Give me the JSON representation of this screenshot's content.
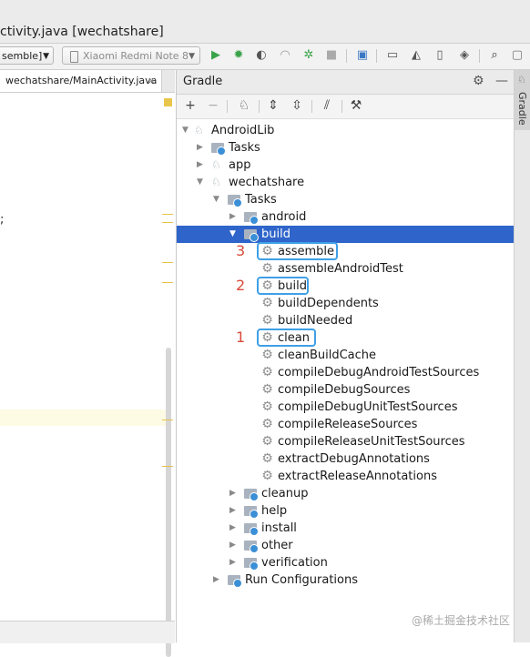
{
  "window": {
    "title": "ctivity.java [wechatshare]"
  },
  "toolbar": {
    "config_combo": "semble]",
    "device_combo": "Xiaomi Redmi Note 8",
    "icons": [
      "run-icon",
      "debug-icon",
      "profile-icon",
      "attach-icon",
      "apply-changes-icon",
      "stop-icon",
      "sync-icon",
      "sdk-manager-icon",
      "avd-manager-icon",
      "device-icon",
      "layout-inspector-icon",
      "search-icon",
      "more-icon"
    ]
  },
  "editor": {
    "tab_label": "wechatshare/MainActivity.java",
    "close_symbol": "×",
    "code_fragment": ";"
  },
  "gradle": {
    "title": "Gradle",
    "settings_symbol": "⚙",
    "minimize_symbol": "—",
    "toolbar": {
      "add": "+",
      "remove": "−"
    },
    "tree": [
      {
        "label": "AndroidLib",
        "level": 0,
        "expanded": true,
        "icon": "elephant-icon"
      },
      {
        "label": "Tasks",
        "level": 1,
        "expanded": false,
        "icon": "folder-icon"
      },
      {
        "label": "app",
        "level": 1,
        "expanded": false,
        "icon": "elephant-icon"
      },
      {
        "label": "wechatshare",
        "level": 1,
        "expanded": true,
        "icon": "elephant-icon"
      },
      {
        "label": "Tasks",
        "level": 2,
        "expanded": true,
        "icon": "folder-icon"
      },
      {
        "label": "android",
        "level": 3,
        "expanded": false,
        "icon": "folder-icon"
      },
      {
        "label": "build",
        "level": 3,
        "expanded": true,
        "icon": "folder-icon",
        "selected": true
      },
      {
        "label": "assemble",
        "level": 4,
        "icon": "gear-icon"
      },
      {
        "label": "assembleAndroidTest",
        "level": 4,
        "icon": "gear-icon"
      },
      {
        "label": "build",
        "level": 4,
        "icon": "gear-icon"
      },
      {
        "label": "buildDependents",
        "level": 4,
        "icon": "gear-icon"
      },
      {
        "label": "buildNeeded",
        "level": 4,
        "icon": "gear-icon"
      },
      {
        "label": "clean",
        "level": 4,
        "icon": "gear-icon"
      },
      {
        "label": "cleanBuildCache",
        "level": 4,
        "icon": "gear-icon"
      },
      {
        "label": "compileDebugAndroidTestSources",
        "level": 4,
        "icon": "gear-icon"
      },
      {
        "label": "compileDebugSources",
        "level": 4,
        "icon": "gear-icon"
      },
      {
        "label": "compileDebugUnitTestSources",
        "level": 4,
        "icon": "gear-icon"
      },
      {
        "label": "compileReleaseSources",
        "level": 4,
        "icon": "gear-icon"
      },
      {
        "label": "compileReleaseUnitTestSources",
        "level": 4,
        "icon": "gear-icon"
      },
      {
        "label": "extractDebugAnnotations",
        "level": 4,
        "icon": "gear-icon"
      },
      {
        "label": "extractReleaseAnnotations",
        "level": 4,
        "icon": "gear-icon"
      },
      {
        "label": "cleanup",
        "level": 3,
        "expanded": false,
        "icon": "folder-icon"
      },
      {
        "label": "help",
        "level": 3,
        "expanded": false,
        "icon": "folder-icon"
      },
      {
        "label": "install",
        "level": 3,
        "expanded": false,
        "icon": "folder-icon"
      },
      {
        "label": "other",
        "level": 3,
        "expanded": false,
        "icon": "folder-icon"
      },
      {
        "label": "verification",
        "level": 3,
        "expanded": false,
        "icon": "folder-icon"
      },
      {
        "label": "Run Configurations",
        "level": 2,
        "expanded": false,
        "icon": "folder-icon"
      }
    ],
    "annotations": [
      {
        "number": "3",
        "target": "assemble"
      },
      {
        "number": "2",
        "target": "build"
      },
      {
        "number": "1",
        "target": "clean"
      }
    ],
    "accent_color": "#2f65ca",
    "annotation_color": "#d84b3a",
    "highlight_box_color": "#3fa0e6"
  },
  "right_strip": {
    "tab_label": "Gradle"
  },
  "watermark": "@稀土掘金技术社区"
}
